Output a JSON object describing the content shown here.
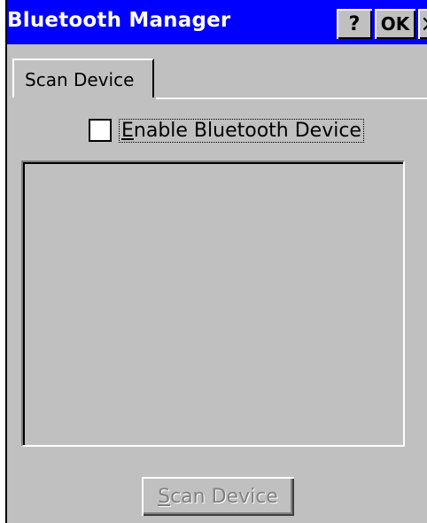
{
  "window": {
    "title": "Bluetooth Manager",
    "help_label": "?",
    "ok_label": "OK",
    "close_label": "×"
  },
  "tabs": [
    {
      "label": "Scan Device",
      "selected": true
    }
  ],
  "enable_checkbox": {
    "label": "Enable Bluetooth Device",
    "checked": false
  },
  "device_list": {
    "items": []
  },
  "scan_button": {
    "label": "Scan Device",
    "enabled": false
  },
  "colors": {
    "title_bar": "#0000ff",
    "dialog_bg": "#c0c0c0",
    "disabled_text": "#808080"
  }
}
